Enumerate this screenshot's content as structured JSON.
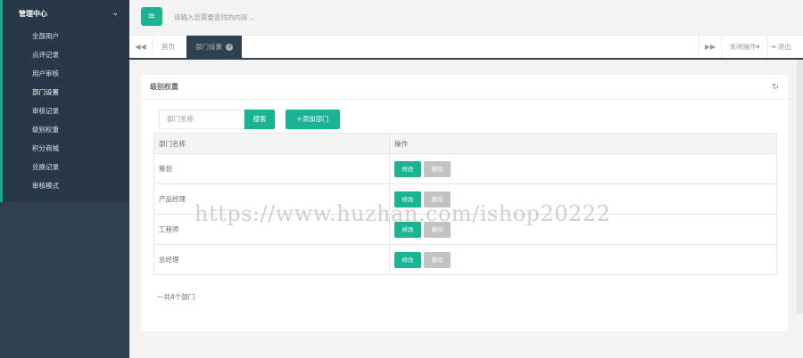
{
  "sidebar": {
    "header": "管理中心",
    "items": [
      {
        "label": "全部用户"
      },
      {
        "label": "点评记录"
      },
      {
        "label": "用户审核"
      },
      {
        "label": "部门设置"
      },
      {
        "label": "审核记录"
      },
      {
        "label": "级别权重"
      },
      {
        "label": "积分商城"
      },
      {
        "label": "兑换记录"
      },
      {
        "label": "审核模式"
      }
    ]
  },
  "topbar": {
    "search_placeholder": "请输入您需要查找的内容 ..."
  },
  "tabs": {
    "home": "首页",
    "active": "部门设置",
    "close_ops": "关闭操作",
    "logout": "退出"
  },
  "panel": {
    "title": "级别权重",
    "search_placeholder": "部门名称",
    "search_button": "搜索",
    "add_button": "+添加部门",
    "columns": [
      "部门名称",
      "操作"
    ],
    "rows": [
      {
        "name": "策划"
      },
      {
        "name": "产品经理"
      },
      {
        "name": "工程师"
      },
      {
        "name": "总经理"
      }
    ],
    "edit_label": "修改",
    "delete_label": "删除",
    "total": "一共4个部门"
  },
  "watermark": "https://www.huzhan.com/ishop20222",
  "colors": {
    "accent": "#1ab394",
    "sidebar_bg": "#2f4050",
    "sidebar_dark": "#293846",
    "delete_gray": "#c2c2c2"
  }
}
